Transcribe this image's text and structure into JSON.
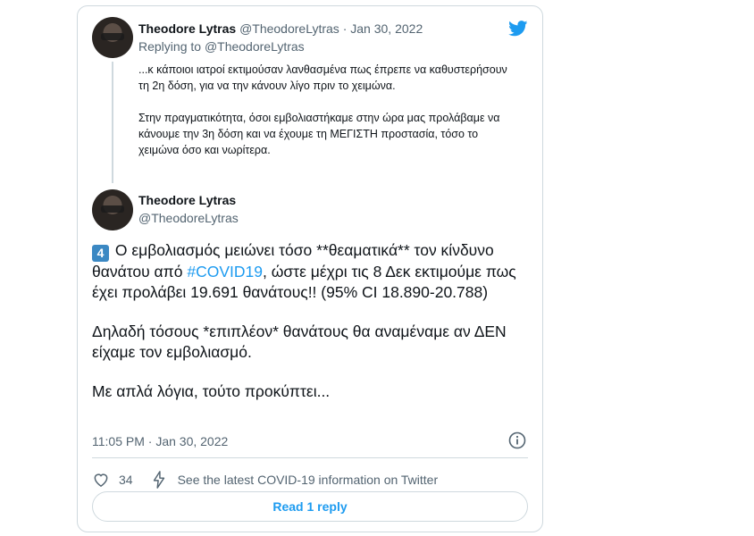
{
  "quoted_tweet": {
    "author_name": "Theodore Lytras",
    "handle": "@TheodoreLytras",
    "separator": " · ",
    "date": "Jan 30, 2022",
    "replying_prefix": "Replying to ",
    "replying_to": "@TheodoreLytras",
    "paragraphs": [
      "...κ κάποιοι ιατροί εκτιμούσαν λανθασμένα πως έπρεπε να καθυστερήσουν τη 2η δόση, για να την κάνουν λίγο πριν το χειμώνα.",
      "Στην πραγματικότητα, όσοι εμβολιαστήκαμε στην ώρα μας προλάβαμε να κάνουμε την 3η δόση και να έχουμε τη ΜΕΓΙΣΤΗ προστασία, τόσο το χειμώνα όσο και νωρίτερα."
    ]
  },
  "main_tweet": {
    "author_name": "Theodore Lytras",
    "handle": "@TheodoreLytras",
    "keycap": "4",
    "text_before_hashtag": " Ο εμβολιασμός μειώνει τόσο **θεαματικά** τον κίνδυνο θανάτου από ",
    "hashtag": "#COVID19",
    "text_after_hashtag": ", ώστε μέχρι τις 8 Δεκ εκτιμούμε πως έχει προλάβει 19.691 θανάτους!! (95% CI 18.890-20.788)",
    "paragraph2": "Δηλαδή τόσους *επιπλέον* θανάτους θα αναμέναμε αν ΔΕΝ είχαμε τον εμβολιασμό.",
    "paragraph3": "Με απλά λόγια, τούτο προκύπτει...",
    "timestamp": "11:05 PM · Jan 30, 2022",
    "like_count": "34",
    "covid_info": "See the latest COVID-19 information on Twitter",
    "read_reply": "Read 1 reply"
  },
  "colors": {
    "accent": "#1d9bf0",
    "muted": "#536471",
    "border": "#cfd9de"
  }
}
